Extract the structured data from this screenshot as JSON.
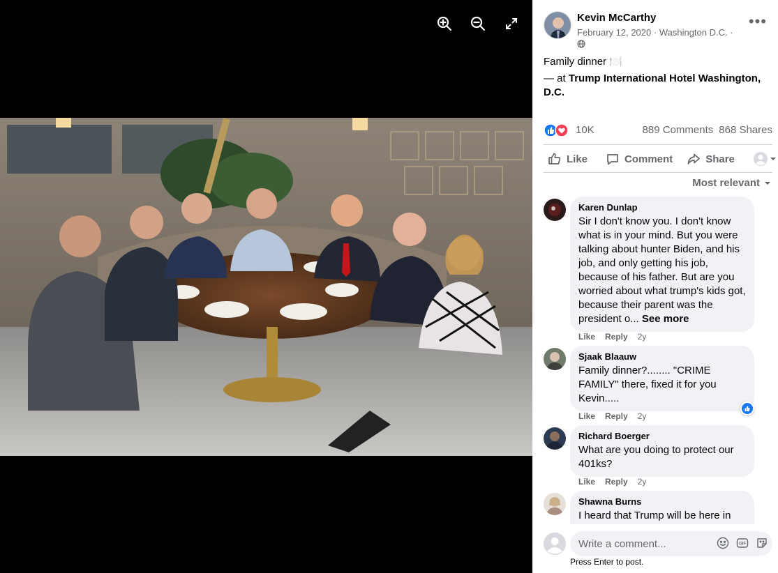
{
  "viewer": {
    "tools": [
      {
        "name": "zoom-in-icon"
      },
      {
        "name": "zoom-out-icon"
      },
      {
        "name": "fullscreen-icon"
      }
    ]
  },
  "post": {
    "author": "Kevin McCarthy",
    "date": "February 12, 2020",
    "location": "Washington D.C.",
    "meta_sep": "·",
    "text": "Family dinner 🍽️",
    "checkin_prefix": "— at ",
    "checkin_place": "Trump International Hotel Washington, D.C.",
    "more_label": "•••"
  },
  "stats": {
    "reactions": "10K",
    "comments": "889 Comments",
    "shares": "868 Shares"
  },
  "actions": {
    "like": "Like",
    "comment": "Comment",
    "share": "Share"
  },
  "sort_label": "Most relevant",
  "comments": [
    {
      "name": "Karen Dunlap",
      "text": "Sir I don't know you. I don't know what is in your mind. But you were talking about hunter Biden, and his job, and only getting his job, because of his father. But are you worried about what trump's kids got, because their parent was the president o...",
      "see_more": "See more",
      "like": "Like",
      "reply": "Reply",
      "time": "2y"
    },
    {
      "name": "Sjaak Blaauw",
      "text": "Family dinner?........ \"CRIME FAMILY\" there, fixed it for you Kevin.....",
      "like": "Like",
      "reply": "Reply",
      "time": "2y"
    },
    {
      "name": "Richard Boerger",
      "text": "What are you doing to protect our 401ks?",
      "like": "Like",
      "reply": "Reply",
      "time": "2y"
    },
    {
      "name": "Shawna Burns",
      "text": "I heard that Trump will be here in Bakersfield... Trump has brought jobs"
    }
  ],
  "composer": {
    "placeholder": "Write a comment...",
    "hint": "Press Enter to post."
  },
  "colors": {
    "like_blue": "#1877f2",
    "love_red": "#f33e58",
    "muted_text": "#65676b",
    "bubble_bg": "#f0f2f5"
  }
}
